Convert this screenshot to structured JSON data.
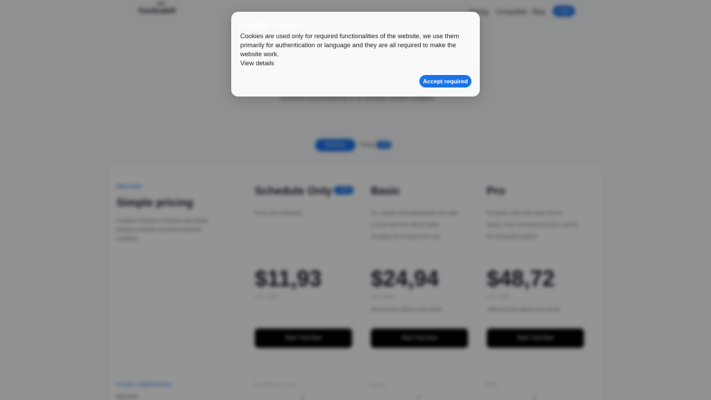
{
  "nav": {
    "logo": "YouScalell",
    "links": [
      "Pricing",
      "Compatible",
      "Blog"
    ],
    "login": "Login"
  },
  "hero": {
    "subtitle": "schedule and publishing or AI-assisted content creation."
  },
  "billing": {
    "monthly": "Monthly",
    "yearly": "Yearly",
    "yearly_badge": "-10%"
  },
  "intro": {
    "kicker": "PRICING",
    "title": "Simple pricing",
    "description": "Compare Ourplans's functions and choose between schedule only and AI powered workflows."
  },
  "plans": [
    {
      "name": "Schedule Only",
      "badge": "-10%",
      "description": "No AI, just scheduling",
      "price": "$11,93",
      "per": "user / month",
      "extra": "",
      "button": "Start Trial Now"
    },
    {
      "name": "Basic",
      "badge": "",
      "description": "For creators and professionals who want to save more time with AI drafts. Templates for AI and much more",
      "price": "$24,94",
      "per": "user / month",
      "extra": "400 premium tokens each month",
      "button": "Start Trial Now"
    },
    {
      "name": "Pro",
      "badge": "",
      "description": "For power users who need more AI tokens, more connected accounts, and the full YouScalell workflow",
      "price": "$48,72",
      "per": "user / month",
      "extra": "1000 premium tokens each month",
      "button": "Start Trial Now"
    }
  ],
  "comparison": {
    "kicker": "PLANS COMPARISON",
    "columns": [
      "SCHEDULE ONLY",
      "BASIC",
      "PRO"
    ],
    "first_feature": "Blog Studio"
  },
  "cookie": {
    "title": "Cookie consent",
    "text": "Cookies are used only for required functionalities of the website, we use them primarily for authentication or language and they are all required to make the website work.",
    "view_details": "View details",
    "accept": "Accept required"
  }
}
